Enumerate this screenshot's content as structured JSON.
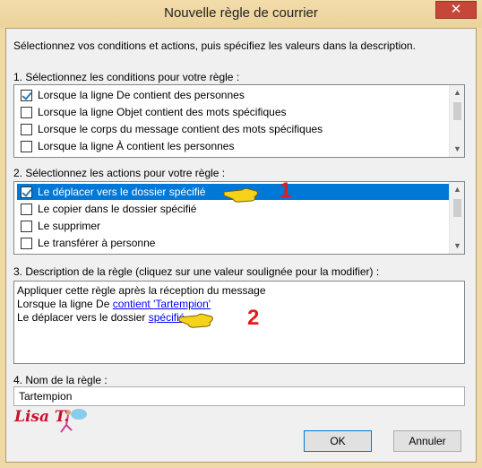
{
  "window": {
    "title": "Nouvelle règle de courrier",
    "close_glyph": "✕"
  },
  "intro": "Sélectionnez vos conditions et actions, puis spécifiez les valeurs dans la description.",
  "conditions": {
    "label": "1. Sélectionnez les conditions pour votre règle :",
    "items": [
      {
        "label": "Lorsque la ligne De contient des personnes",
        "checked": true
      },
      {
        "label": "Lorsque la ligne Objet contient des mots spécifiques",
        "checked": false
      },
      {
        "label": "Lorsque le corps du message contient des mots spécifiques",
        "checked": false
      },
      {
        "label": "Lorsque la ligne À contient les personnes",
        "checked": false
      }
    ]
  },
  "actions": {
    "label": "2. Sélectionnez les actions pour votre règle :",
    "items": [
      {
        "label": "Le déplacer vers le dossier spécifié",
        "checked": true,
        "selected": true
      },
      {
        "label": "Le copier dans le dossier spécifié",
        "checked": false
      },
      {
        "label": "Le supprimer",
        "checked": false
      },
      {
        "label": "Le transférer à personne",
        "checked": false
      }
    ]
  },
  "description": {
    "label": "3. Description de la règle (cliquez sur une valeur soulignée pour la modifier) :",
    "line1": "Appliquer cette règle après la réception du message",
    "line2_text": "Lorsque la ligne De ",
    "line2_link": "contient 'Tartempion'",
    "line3_text": "Le déplacer vers le dossier ",
    "line3_link": "spécifié"
  },
  "rule_name": {
    "label": "4. Nom de la règle :",
    "value": "Tartempion"
  },
  "buttons": {
    "ok": "OK",
    "cancel": "Annuler"
  },
  "annotations": {
    "step1": "1",
    "step2": "2",
    "watermark": "Lisa T."
  },
  "colors": {
    "selection": "#0078d7",
    "link": "#0000ff",
    "annotation": "#e21b1b",
    "close": "#c7463a"
  }
}
